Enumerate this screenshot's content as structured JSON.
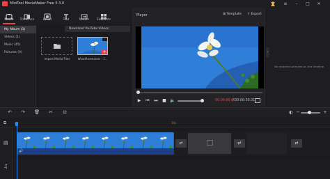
{
  "app": {
    "title": "MiniTool MovieMaker Free 5.3.0"
  },
  "window_controls": [
    "settings-icon",
    "menu-icon",
    "minimize-icon",
    "maximize-icon",
    "close-icon"
  ],
  "toolbar": {
    "tabs": [
      {
        "label": "Media",
        "icon": "media-icon",
        "active": true
      },
      {
        "label": "Transition",
        "icon": "transition-icon"
      },
      {
        "label": "Effect",
        "icon": "effect-icon"
      },
      {
        "label": "Text",
        "icon": "text-icon"
      },
      {
        "label": "Motion",
        "icon": "motion-icon"
      },
      {
        "label": "Elements",
        "icon": "elements-icon"
      }
    ]
  },
  "sidebar": {
    "items": [
      {
        "label": "My Album (1)",
        "active": true
      },
      {
        "label": "Videos (1)"
      },
      {
        "label": "Music (45)"
      },
      {
        "label": "Pictures (0)"
      }
    ]
  },
  "media": {
    "download_label": "Download YouTube Videos",
    "import_label": "Import Media Files",
    "clip_label": "WoodAnemones - 1..."
  },
  "player": {
    "title": "Player",
    "template_label": "Template",
    "export_label": "Export",
    "time_current": "00:00:00.00",
    "time_separator": "/",
    "time_total": "00:00:30.01"
  },
  "properties": {
    "empty_message": "No material selected on the timeline"
  },
  "timeline": {
    "ruler_mark": "30s",
    "tools": [
      "undo-icon",
      "redo-icon",
      "delete-icon",
      "split-icon",
      "crop-icon"
    ]
  },
  "colors": {
    "accent": "#e8434f",
    "playhead": "#2b8af0",
    "clip": "#2d5dbd",
    "sky": "#2f7fd8"
  }
}
